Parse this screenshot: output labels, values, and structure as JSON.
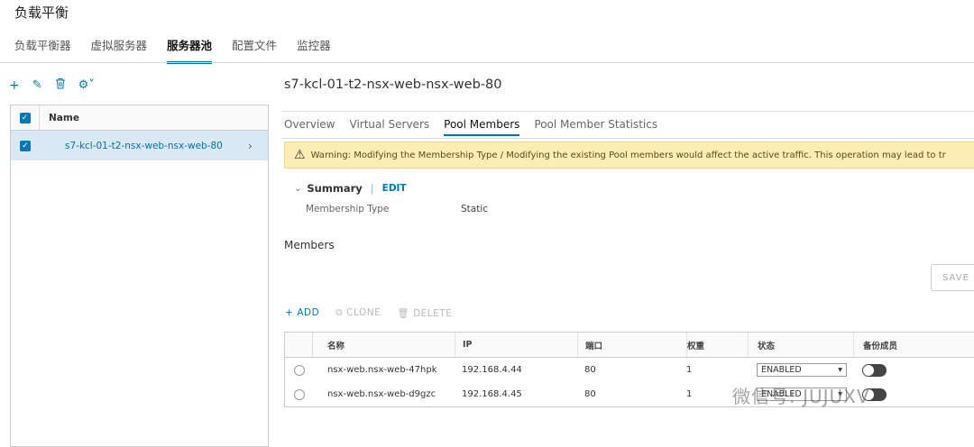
{
  "page": {
    "title": "负载平衡"
  },
  "topnav": {
    "tabs": [
      {
        "label": "负载平衡器"
      },
      {
        "label": "虚拟服务器"
      },
      {
        "label": "服务器池"
      },
      {
        "label": "配置文件"
      },
      {
        "label": "监控器"
      }
    ],
    "active_index": 2
  },
  "toolbar": {
    "add_icon": "plus-icon",
    "edit_icon": "pencil-icon",
    "delete_icon": "trash-icon",
    "settings_icon": "gear-icon",
    "add_glyph": "+",
    "edit_glyph": "✎",
    "delete_glyph": "🗑",
    "settings_glyph": "⚙˅"
  },
  "pool_list": {
    "header": "Name",
    "items": [
      {
        "name": "s7-kcl-01-t2-nsx-web-nsx-web-80",
        "selected": true
      }
    ]
  },
  "detail": {
    "title": "s7-kcl-01-t2-nsx-web-nsx-web-80",
    "tabs": [
      {
        "label": "Overview"
      },
      {
        "label": "Virtual Servers"
      },
      {
        "label": "Pool Members"
      },
      {
        "label": "Pool Member Statistics"
      }
    ],
    "active_tab": 2,
    "warning": "Warning: Modifying the Membership Type / Modifying the existing Pool members would affect the active traffic. This operation may lead to tr",
    "summary": {
      "label": "Summary",
      "edit": "EDIT",
      "membership_type_label": "Membership Type",
      "membership_type_value": "Static"
    },
    "members_title": "Members",
    "save": "SAVE",
    "actions": {
      "add": "ADD",
      "clone": "CLONE",
      "delete": "DELETE"
    },
    "grid": {
      "columns": [
        "名称",
        "IP",
        "端口",
        "权重",
        "状态",
        "备份成员"
      ],
      "rows": [
        {
          "name": "nsx-web.nsx-web-47hpk",
          "ip": "192.168.4.44",
          "port": "80",
          "weight": "1",
          "status": "ENABLED",
          "backup": false
        },
        {
          "name": "nsx-web.nsx-web-d9gzc",
          "ip": "192.168.4.45",
          "port": "80",
          "weight": "1",
          "status": "ENABLED",
          "backup": false
        }
      ]
    }
  },
  "watermark": "微信号: JUJUXV",
  "colors": {
    "accent": "#0079b8",
    "selected_row": "#d9e8f3",
    "warning_bg": "#feecb5"
  }
}
